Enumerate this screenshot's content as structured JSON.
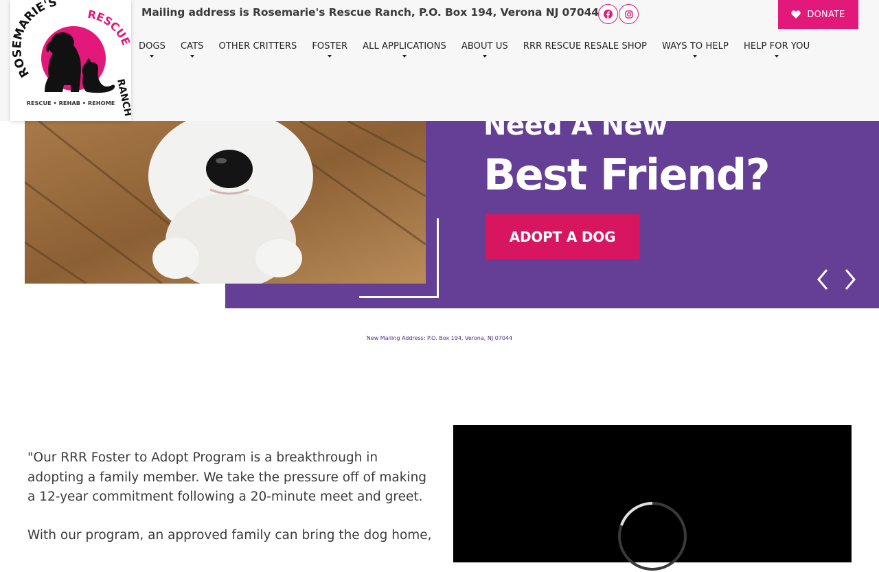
{
  "header": {
    "mailing_address": "Mailing address is Rosemarie's Rescue Ranch, P.O. Box 194, Verona NJ 07044",
    "donate_label": "DONATE",
    "social": [
      "facebook-icon",
      "instagram-icon"
    ]
  },
  "logo": {
    "text_top": "ROSEMARIE'S",
    "text_rescue": "RESCUE",
    "text_ranch": "RANCH",
    "tagline": "RESCUE • REHAB • REHOME"
  },
  "nav": [
    {
      "label": "DOGS",
      "dropdown": true
    },
    {
      "label": "CATS",
      "dropdown": true
    },
    {
      "label": "OTHER CRITTERS",
      "dropdown": false
    },
    {
      "label": "FOSTER",
      "dropdown": true
    },
    {
      "label": "ALL APPLICATIONS",
      "dropdown": true
    },
    {
      "label": "ABOUT US",
      "dropdown": true
    },
    {
      "label": "RRR RESCUE RESALE SHOP",
      "dropdown": false
    },
    {
      "label": "WAYS TO HELP",
      "dropdown": true
    },
    {
      "label": "HELP FOR YOU",
      "dropdown": true
    }
  ],
  "hero": {
    "heading_small": "Need A New",
    "heading": "Best Friend?",
    "button_label": "ADOPT A DOG"
  },
  "notice": "New Mailing Address: P.O. Box 194, Verona, NJ 07044",
  "intro": {
    "paragraph1": "\"Our RRR Foster to Adopt Program is a breakthrough in adopting a family member. We take the pressure off of making a 12-year commitment following a 20-minute meet and greet.",
    "paragraph2": "With our program, an approved family can bring the dog home,"
  },
  "colors": {
    "accent_pink": "#e2187a",
    "hero_purple": "#653f96",
    "button_pink": "#d7165f",
    "header_bg": "#f7f7f7"
  }
}
